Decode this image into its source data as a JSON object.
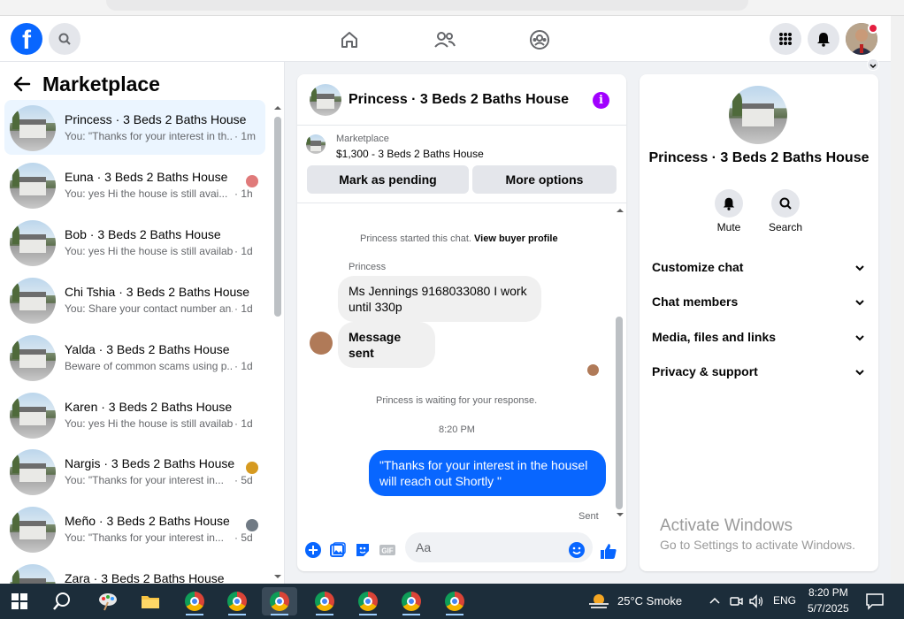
{
  "header": {
    "logo": "f",
    "icons": [
      "search-icon",
      "home-icon",
      "friends-icon",
      "groups-icon",
      "apps-grid-icon",
      "bell-icon"
    ]
  },
  "left": {
    "title": "Marketplace",
    "conversations": [
      {
        "name": "Princess · 3 Beds 2 Baths House",
        "snippet": "You: \"Thanks for your interest in th...",
        "time": "· 1m",
        "active": true
      },
      {
        "name": "Euna · 3 Beds 2 Baths House",
        "snippet": "You: yes Hi the house is still avai...",
        "time": "· 1h"
      },
      {
        "name": "Bob · 3 Beds 2 Baths House",
        "snippet": "You: yes Hi the house is still availab...",
        "time": "· 1d"
      },
      {
        "name": "Chi Tshia · 3 Beds 2 Baths House",
        "snippet": "You: Share your contact number an...",
        "time": "· 1d"
      },
      {
        "name": "Yalda · 3 Beds 2 Baths House",
        "snippet": "Beware of common scams using p...",
        "time": "· 1d"
      },
      {
        "name": "Karen · 3 Beds 2 Baths House",
        "snippet": "You: yes Hi the house is still availab...",
        "time": "· 1d"
      },
      {
        "name": "Nargis · 3 Beds 2 Baths House",
        "snippet": "You: \"Thanks for your interest in...",
        "time": "· 5d"
      },
      {
        "name": "Meño · 3 Beds 2 Baths House",
        "snippet": "You: \"Thanks for your interest in...",
        "time": "· 5d"
      },
      {
        "name": "Zara · 3 Beds 2 Baths House",
        "snippet": "",
        "time": ""
      }
    ]
  },
  "chat": {
    "title": "Princess · 3 Beds 2 Baths House",
    "info_glyph": "i",
    "listing_label": "Marketplace",
    "listing_price": "$1,300 - 3 Beds 2 Baths House",
    "mark_pending": "Mark as pending",
    "more_options": "More options",
    "started_text": "Princess started this chat.",
    "view_profile": "View buyer profile",
    "sender_name": "Princess",
    "msg1": "Ms Jennings 9168033080 I work until 330p",
    "msg2": "Message sent",
    "waiting": "Princess is waiting for your response.",
    "time": "8:20 PM",
    "my_msg": "\"Thanks for your interest in the housel will reach out Shortly \"",
    "sent": "Sent",
    "placeholder": "Aa"
  },
  "details": {
    "name": "Princess · 3 Beds 2 Baths House",
    "mute": "Mute",
    "search": "Search",
    "rows": [
      "Customize chat",
      "Chat members",
      "Media, files and links",
      "Privacy & support"
    ]
  },
  "watermark": {
    "line1": "Activate Windows",
    "line2": "Go to Settings to activate Windows."
  },
  "taskbar": {
    "weather": "25°C  Smoke",
    "lang": "ENG",
    "clock_time": "8:20 PM",
    "clock_date": "5/7/2025"
  },
  "colors": {
    "accent": "#0866ff",
    "info": "#a100ff",
    "taskbar": "#1c2d3a"
  }
}
